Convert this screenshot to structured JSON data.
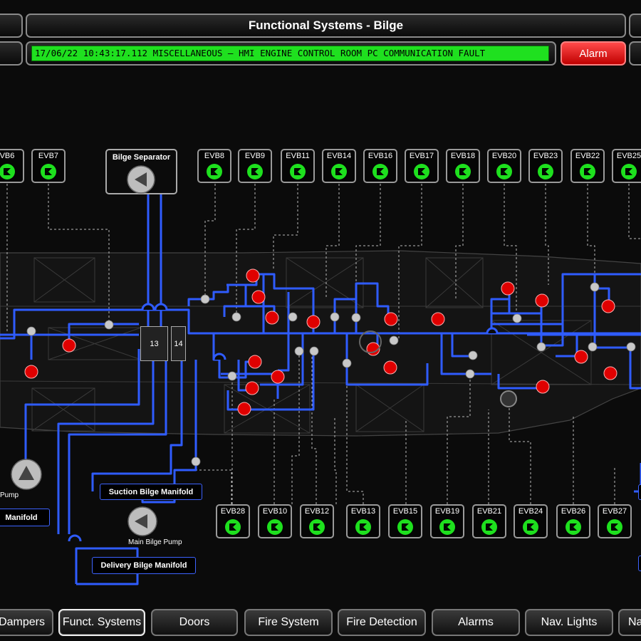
{
  "header": {
    "title": "Functional Systems - Bilge"
  },
  "alarm_strip": {
    "text": "17/06/22   10:43:17.112   MISCELLANEOUS – HMI ENGINE CONTROL ROOM PC COMMUNICATION FAULT",
    "color": "#1fe01f"
  },
  "alarm_button": {
    "label": "Alarm",
    "color": "#e00000"
  },
  "top_valves": [
    "VB6",
    "EVB7",
    "EVB8",
    "EVB9",
    "EVB11",
    "EVB14",
    "EVB16",
    "EVB17",
    "EVB18",
    "EVB20",
    "EVB23",
    "EVB22",
    "EVB25"
  ],
  "bottom_valves": [
    "EVB28",
    "EVB10",
    "EVB12",
    "EVB13",
    "EVB15",
    "EVB19",
    "EVB21",
    "EVB24",
    "EVB26",
    "EVB27"
  ],
  "bilge_separator": {
    "label": "Bilge Separator"
  },
  "pumps_boxes": {
    "box_13": "13",
    "box_14": "14"
  },
  "labels": {
    "suction_bilge_manifold": "Suction Bilge Manifold",
    "delivery_bilge_manifold": "Delivery Bilge Manifold",
    "main_bilge_pump": "Main Bilge Pump",
    "left_pump": "Pump",
    "left_manifold": "Manifold"
  },
  "nav": {
    "buttons": [
      "Dampers",
      "Funct. Systems",
      "Doors",
      "Fire System",
      "Fire Detection",
      "Alarms",
      "Nav. Lights",
      "Na"
    ],
    "active": "Funct. Systems"
  },
  "colors": {
    "pipe": "#2f5cff",
    "valve_open": "#1ee01e",
    "alarm_point": "#e00000",
    "junction": "#c8c8c8"
  }
}
